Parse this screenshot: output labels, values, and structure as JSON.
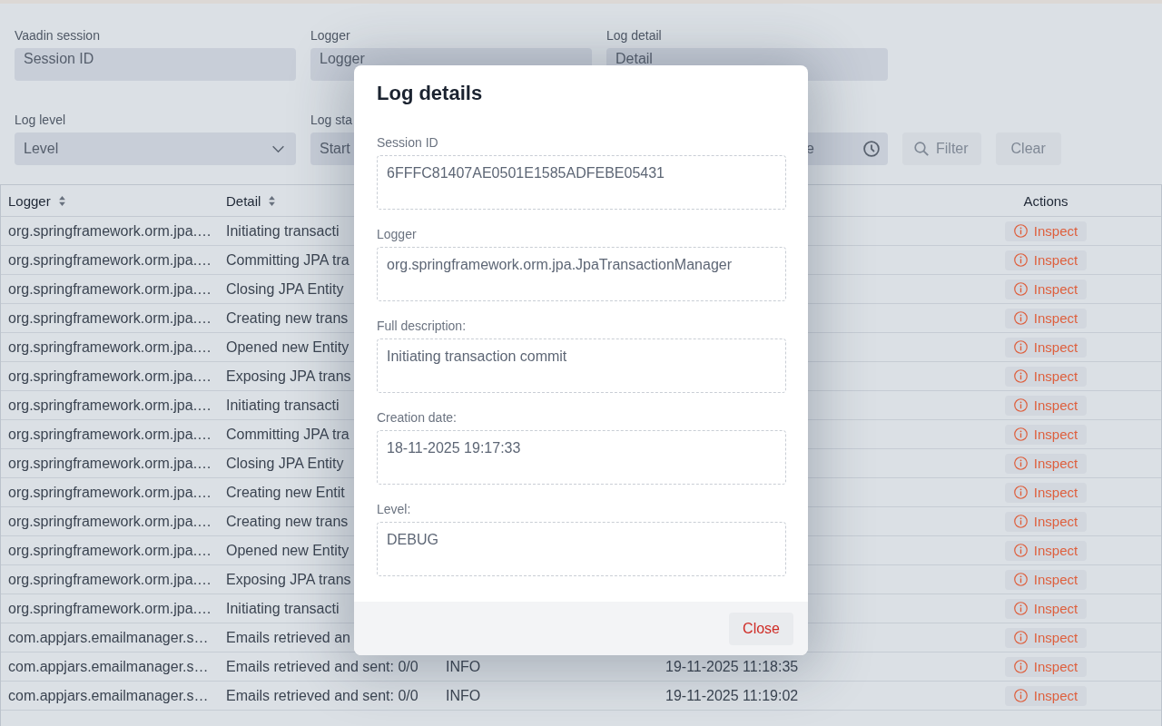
{
  "filter_rows": [
    [
      {
        "kind": "text",
        "label": "Vaadin session",
        "placeholder": "Session ID"
      },
      {
        "kind": "text",
        "label": "Logger",
        "placeholder": "Logger"
      },
      {
        "kind": "text",
        "label": "Log detail",
        "placeholder": "Detail"
      }
    ],
    [
      {
        "kind": "select",
        "label": "Log level",
        "placeholder": "Level"
      },
      {
        "kind": "datetime",
        "label": "Log sta",
        "placeholder": "Start",
        "time_placeholder": "e"
      },
      {
        "kind": "filter",
        "label": "Filter",
        "disabled": true
      },
      {
        "kind": "clear",
        "label": "Clear",
        "disabled": true
      }
    ]
  ],
  "table": {
    "columns": [
      {
        "label": "Logger",
        "sortable": true
      },
      {
        "label": "Detail",
        "sortable": true
      },
      {
        "label": "Actions",
        "sortable": false
      }
    ],
    "rows": [
      {
        "logger": "org.springframework.orm.jpa.…",
        "detail": "Initiating transacti",
        "action": "Inspect"
      },
      {
        "logger": "org.springframework.orm.jpa.…",
        "detail": "Committing JPA tra",
        "action": "Inspect"
      },
      {
        "logger": "org.springframework.orm.jpa.…",
        "detail": "Closing JPA Entity",
        "action": "Inspect"
      },
      {
        "logger": "org.springframework.orm.jpa.…",
        "detail": "Creating new trans",
        "action": "Inspect"
      },
      {
        "logger": "org.springframework.orm.jpa.…",
        "detail": "Opened new Entity",
        "action": "Inspect"
      },
      {
        "logger": "org.springframework.orm.jpa.…",
        "detail": "Exposing JPA trans",
        "action": "Inspect"
      },
      {
        "logger": "org.springframework.orm.jpa.…",
        "detail": "Initiating transacti",
        "action": "Inspect"
      },
      {
        "logger": "org.springframework.orm.jpa.…",
        "detail": "Committing JPA tra",
        "action": "Inspect"
      },
      {
        "logger": "org.springframework.orm.jpa.…",
        "detail": "Closing JPA Entity",
        "action": "Inspect"
      },
      {
        "logger": "org.springframework.orm.jpa.…",
        "detail": "Creating new Entit",
        "action": "Inspect"
      },
      {
        "logger": "org.springframework.orm.jpa.…",
        "detail": "Creating new trans",
        "action": "Inspect"
      },
      {
        "logger": "org.springframework.orm.jpa.…",
        "detail": "Opened new Entity",
        "action": "Inspect"
      },
      {
        "logger": "org.springframework.orm.jpa.…",
        "detail": "Exposing JPA trans",
        "action": "Inspect"
      },
      {
        "logger": "org.springframework.orm.jpa.…",
        "detail": "Initiating transacti",
        "action": "Inspect"
      },
      {
        "logger": "com.appjars.emailmanager.s…",
        "detail": "Emails retrieved an",
        "action": "Inspect"
      },
      {
        "logger": "com.appjars.emailmanager.s…",
        "detail": "Emails retrieved and sent: 0/0",
        "level": "INFO",
        "date": "19-11-2025 11:18:35",
        "action": "Inspect"
      },
      {
        "logger": "com.appjars.emailmanager.s…",
        "detail": "Emails retrieved and sent: 0/0",
        "level": "INFO",
        "date": "19-11-2025 11:19:02",
        "action": "Inspect"
      }
    ]
  },
  "dialog": {
    "title": "Log details",
    "fields": [
      {
        "label": "Session ID",
        "value": "6FFFC81407AE0501E1585ADFEBE05431"
      },
      {
        "label": "Logger",
        "value": "org.springframework.orm.jpa.JpaTransactionManager"
      },
      {
        "label": "Full description:",
        "value": "Initiating transaction commit"
      },
      {
        "label": "Creation date:",
        "value": "18-11-2025 19:17:33"
      },
      {
        "label": "Level:",
        "value": "DEBUG"
      }
    ],
    "buttons": [
      "Close"
    ]
  }
}
